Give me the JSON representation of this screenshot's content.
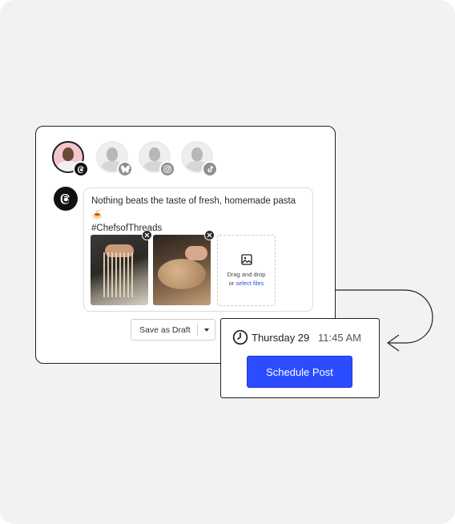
{
  "accounts": [
    {
      "platform": "threads",
      "icon": "threads-icon",
      "active": true
    },
    {
      "platform": "bluesky",
      "icon": "butterfly-icon",
      "active": false
    },
    {
      "platform": "instagram",
      "icon": "instagram-icon",
      "active": false
    },
    {
      "platform": "tiktok",
      "icon": "tiktok-icon",
      "active": false
    }
  ],
  "post": {
    "text_line1": "Nothing beats the taste of fresh, homemade pasta 🍝",
    "text_line2": "#ChefsofThreads",
    "media": [
      {
        "name": "pasta-noodles-image"
      },
      {
        "name": "dough-shaping-image"
      }
    ],
    "drop_zone": {
      "line1": "Drag and drop",
      "line2_prefix": "or ",
      "link": "select files"
    }
  },
  "draft_button": {
    "label": "Save as Draft"
  },
  "schedule": {
    "day": "Thursday 29",
    "time": "11:45 AM",
    "button_label": "Schedule Post"
  },
  "colors": {
    "accent": "#2b4dff",
    "link": "#2451e6",
    "background": "#f2f2f2"
  }
}
